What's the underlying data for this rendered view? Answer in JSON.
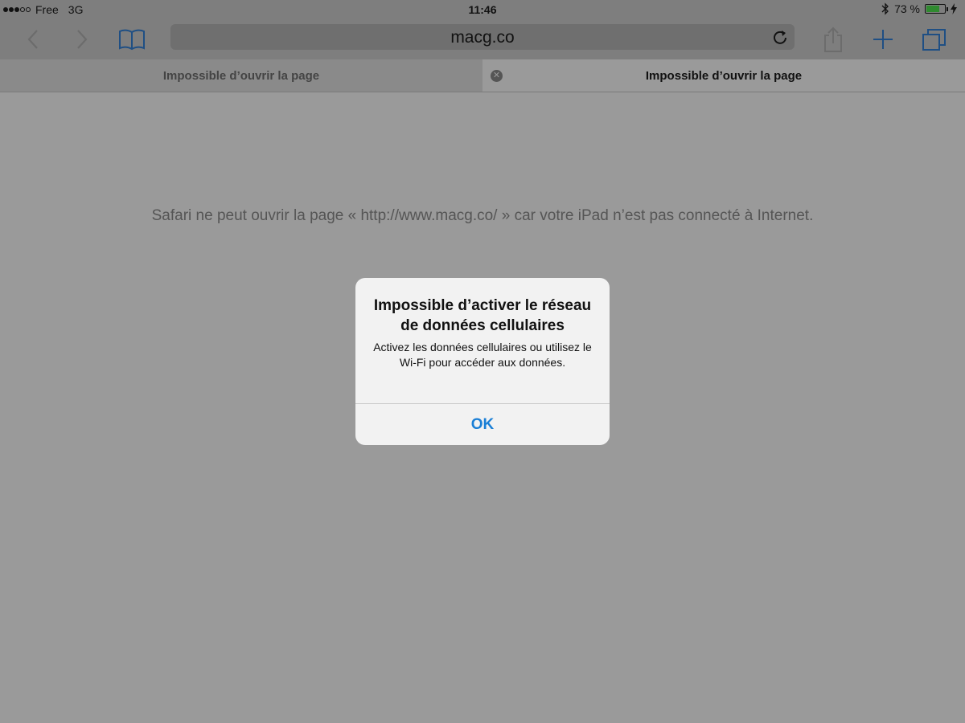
{
  "status_bar": {
    "carrier": "Free",
    "network": "3G",
    "time": "11:46",
    "battery_percent": "73 %",
    "battery_level": 0.73,
    "icons": [
      "signal-dots-icon",
      "bluetooth-icon",
      "battery-icon",
      "charging-bolt-icon"
    ]
  },
  "toolbar": {
    "url": "macg.co",
    "icons": [
      "back-icon",
      "forward-icon",
      "bookmarks-icon",
      "reload-icon",
      "share-icon",
      "add-icon",
      "tabs-icon"
    ]
  },
  "tabs": [
    {
      "label": "Impossible d’ouvrir la page",
      "active": false
    },
    {
      "label": "Impossible d’ouvrir la page",
      "active": true
    }
  ],
  "page": {
    "error_message": "Safari ne peut ouvrir la page « http://www.macg.co/ » car votre iPad n’est pas connecté à Internet."
  },
  "alert": {
    "title": "Impossible d’activer le réseau de données cellulaires",
    "body": "Activez les données cellulaires ou utilisez le Wi-Fi pour accéder aux données.",
    "ok_label": "OK"
  },
  "colors": {
    "accent": "#1a7fd6",
    "dim_accent": "#1f4f84",
    "battery_green": "#2f8a2f"
  }
}
